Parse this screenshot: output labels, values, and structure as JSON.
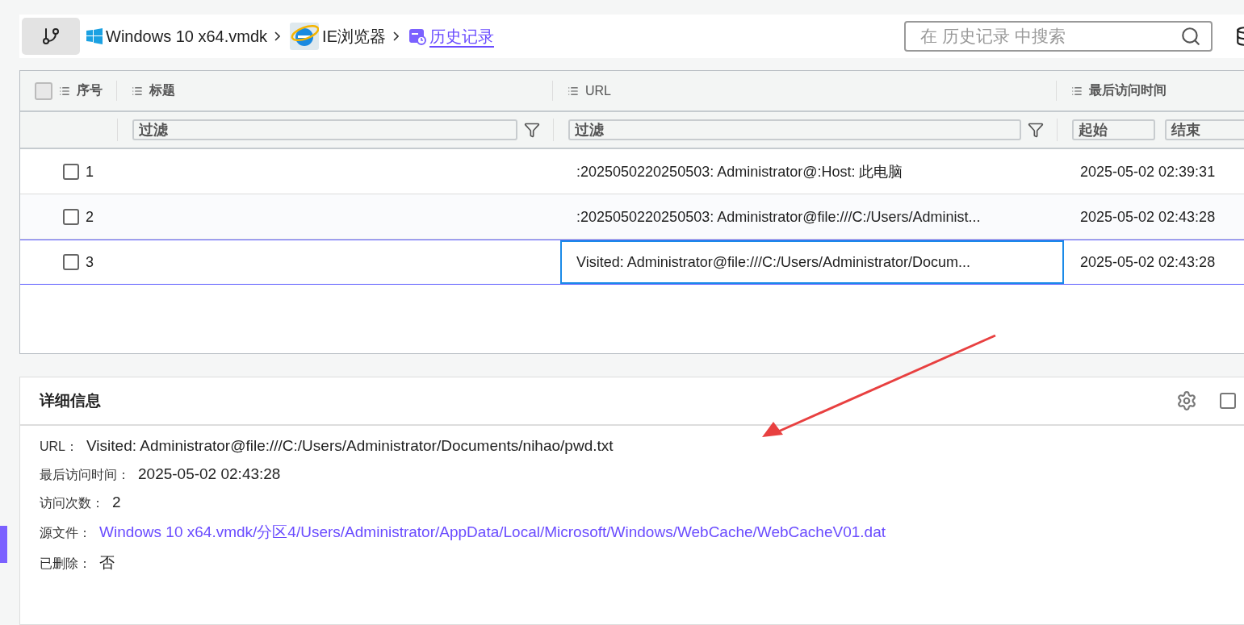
{
  "breadcrumb": [
    {
      "kind": "disk",
      "label": "Windows 10 x64.vmdk",
      "current": false
    },
    {
      "kind": "browser",
      "label": "IE浏览器",
      "current": false
    },
    {
      "kind": "history",
      "label": "历史记录",
      "current": true
    }
  ],
  "search": {
    "placeholder": "在 历史记录 中搜索"
  },
  "table": {
    "columns": [
      {
        "label": "序号"
      },
      {
        "label": "标题"
      },
      {
        "label": "URL"
      },
      {
        "label": "最后访问时间"
      }
    ],
    "filters": {
      "title": "过滤",
      "url": "过滤",
      "start": "起始",
      "end": "结束"
    },
    "select_all": {
      "checked": false
    },
    "rows": [
      {
        "index": "1",
        "checked": false,
        "selected": false,
        "url": ":2025050220250503: Administrator@:Host: 此电脑",
        "time": "2025-05-02 02:39:31"
      },
      {
        "index": "2",
        "checked": false,
        "selected": false,
        "url": ":2025050220250503: Administrator@file:///C:/Users/Administ...",
        "time": "2025-05-02 02:43:28"
      },
      {
        "index": "3",
        "checked": false,
        "selected": true,
        "url": "Visited: Administrator@file:///C:/Users/Administrator/Docum...",
        "time": "2025-05-02 02:43:28"
      }
    ]
  },
  "details": {
    "title": "详细信息",
    "fields": [
      {
        "kind": "text",
        "label": "URL：",
        "value": "Visited: Administrator@file:///C:/Users/Administrator/Documents/nihao/pwd.txt"
      },
      {
        "kind": "text",
        "label": "最后访问时间：",
        "value": "2025-05-02 02:43:28"
      },
      {
        "kind": "text",
        "label": "访问次数：",
        "value": "2"
      },
      {
        "kind": "link",
        "label": "源文件：",
        "value": "Windows 10 x64.vmdk/分区4/Users/Administrator/AppData/Local/Microsoft/Windows/WebCache/WebCacheV01.dat"
      },
      {
        "kind": "text",
        "label": "已删除：",
        "value": "否"
      }
    ]
  }
}
